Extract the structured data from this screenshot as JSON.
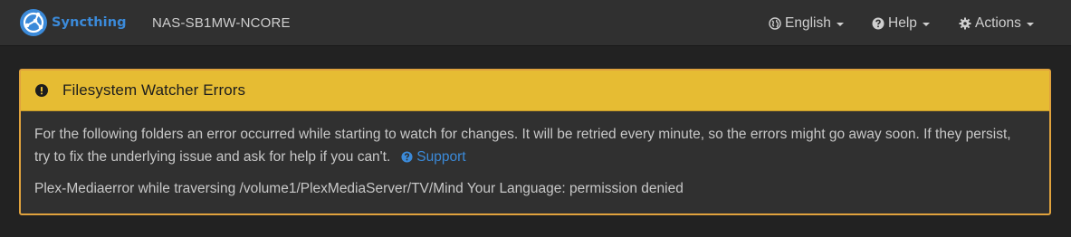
{
  "navbar": {
    "brand": "Syncthing",
    "device_name": "NAS-SB1MW-NCORE",
    "language": "English",
    "help": "Help",
    "actions": "Actions"
  },
  "panel": {
    "title": "Filesystem Watcher Errors",
    "message": "For the following folders an error occurred while starting to watch for changes. It will be retried every minute, so the errors might go away soon. If they persist, try to fix the underlying issue and ask for help if you can't.",
    "support_label": "Support",
    "errors": [
      {
        "folder": "Plex-Media",
        "error": "error while traversing /volume1/PlexMediaServer/TV/Mind Your Language: permission denied"
      }
    ]
  },
  "colors": {
    "brand": "#3b8ad9",
    "warning_heading": "#e6bc33",
    "warning_border": "#e0a23d",
    "background": "#222222"
  }
}
